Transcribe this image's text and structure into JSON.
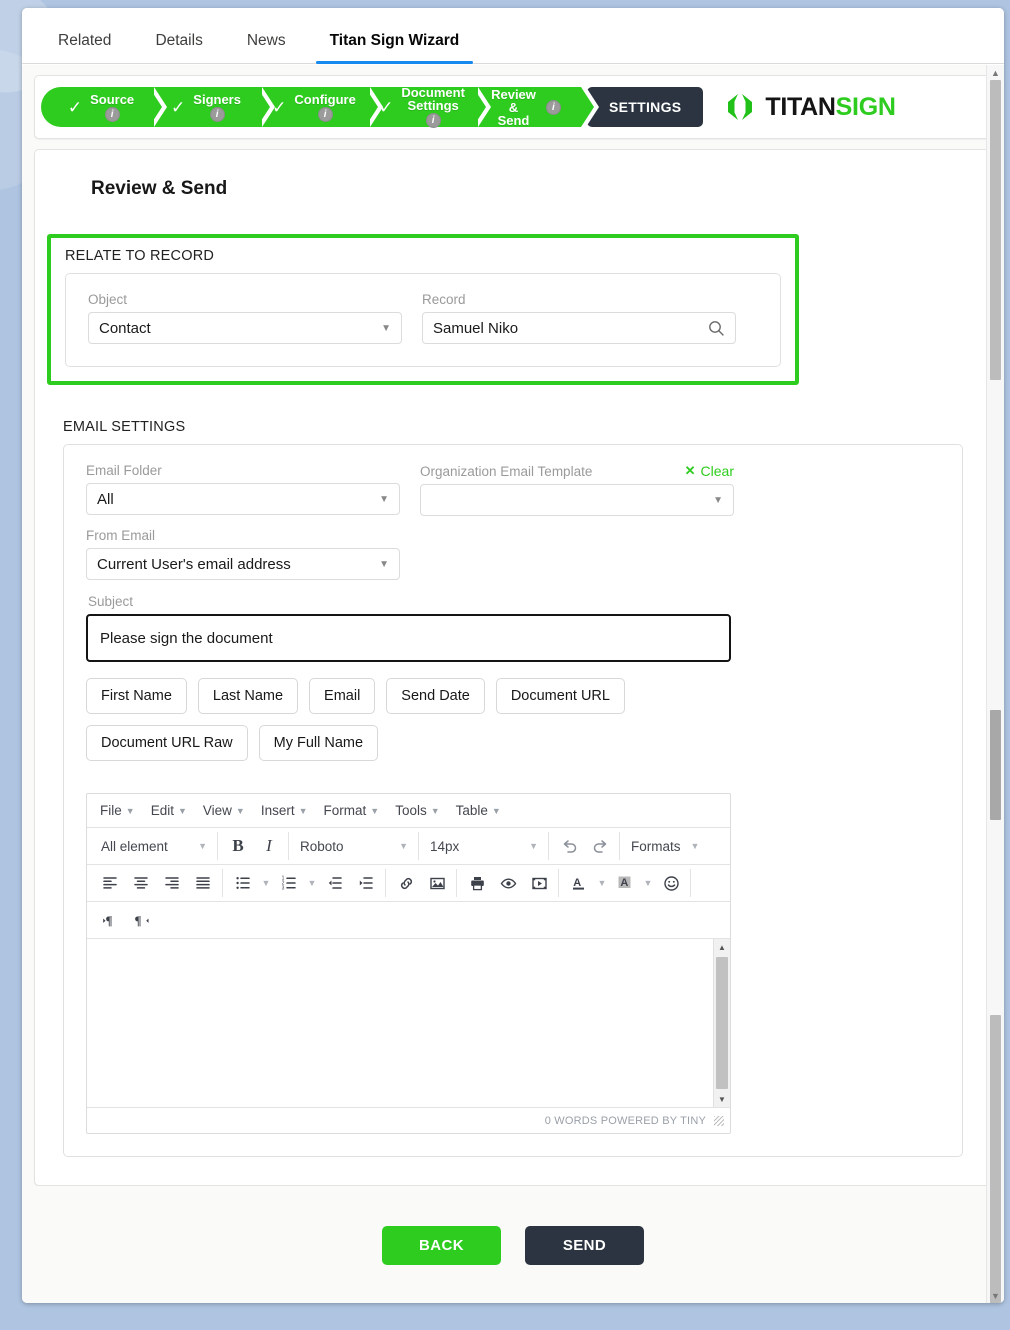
{
  "tabs": [
    {
      "label": "Related",
      "active": false
    },
    {
      "label": "Details",
      "active": false
    },
    {
      "label": "News",
      "active": false
    },
    {
      "label": "Titan Sign Wizard",
      "active": true
    }
  ],
  "wizard": {
    "steps": [
      {
        "label_line1": "Source",
        "label_line2": "",
        "checked": true,
        "info": "i"
      },
      {
        "label_line1": "Signers",
        "label_line2": "",
        "checked": true,
        "info": "i"
      },
      {
        "label_line1": "Configure",
        "label_line2": "",
        "checked": true,
        "info": "i"
      },
      {
        "label_line1": "Document",
        "label_line2": "Settings",
        "checked": true,
        "info": "i"
      },
      {
        "label_line1": "Review",
        "label_line2": "&",
        "label_line3": "Send",
        "checked": false,
        "info": "i"
      }
    ],
    "settings_button": "SETTINGS",
    "brand_primary": "TITAN",
    "brand_secondary": "SIGN",
    "brand_color": "#2ecc1f"
  },
  "page_title": "Review & Send",
  "relate_to_record": {
    "section_title": "RELATE TO RECORD",
    "highlight_color": "#2ecc1f",
    "object": {
      "label": "Object",
      "value": "Contact",
      "icon": "chevron-down-icon"
    },
    "record": {
      "label": "Record",
      "value": "Samuel Niko",
      "icon": "search-icon"
    }
  },
  "email_settings": {
    "section_title": "EMAIL SETTINGS",
    "email_folder": {
      "label": "Email Folder",
      "value": "All"
    },
    "org_template": {
      "label": "Organization Email Template",
      "value": "",
      "placeholder": "",
      "clear_label": "Clear",
      "clear_icon": "close-icon"
    },
    "from_email": {
      "label": "From Email",
      "value": "Current User's email address"
    },
    "subject": {
      "label": "Subject",
      "value": "Please sign the document"
    },
    "merge_chips": [
      "First Name",
      "Last Name",
      "Email",
      "Send Date",
      "Document URL",
      "Document URL Raw",
      "My Full Name"
    ]
  },
  "editor": {
    "menubar": [
      "File",
      "Edit",
      "View",
      "Insert",
      "Format",
      "Tools",
      "Table"
    ],
    "element_select": "All element",
    "font_family": "Roboto",
    "font_size": "14px",
    "formats_label": "Formats",
    "toolbar_icons": [
      "align-left-icon",
      "align-center-icon",
      "align-right-icon",
      "align-justify-icon",
      "bullet-list-icon",
      "numbered-list-icon",
      "outdent-icon",
      "indent-icon",
      "link-icon",
      "image-icon",
      "print-icon",
      "preview-icon",
      "media-icon",
      "text-color-icon",
      "background-color-icon",
      "emoticon-icon",
      "ltr-icon",
      "rtl-icon"
    ],
    "bold_label": "B",
    "italic_label": "I",
    "undo_icon": "undo-icon",
    "redo_icon": "redo-icon",
    "content": "",
    "status_text": "0 WORDS POWERED BY TINY"
  },
  "footer": {
    "back_label": "BACK",
    "back_color": "#2ecc1f",
    "send_label": "SEND",
    "send_color": "#2b3440"
  }
}
